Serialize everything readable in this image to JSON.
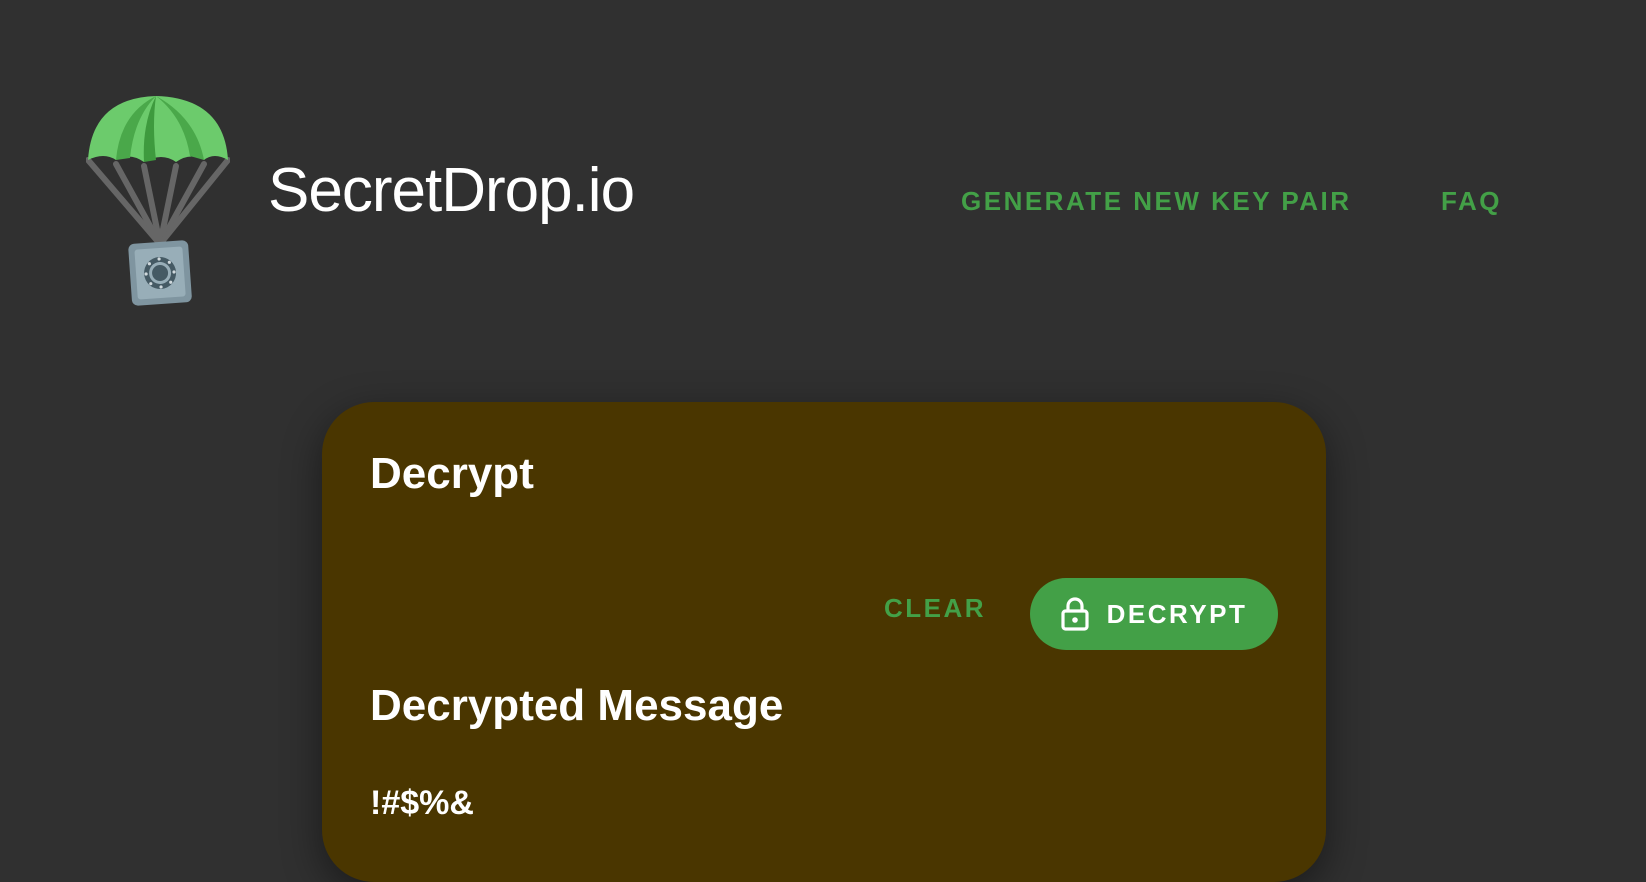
{
  "header": {
    "logo_icon": "parachute-safe-icon",
    "brand": "SecretDrop.io",
    "nav": [
      {
        "label": "GENERATE NEW KEY PAIR"
      },
      {
        "label": "FAQ"
      }
    ]
  },
  "card": {
    "title": "Decrypt",
    "clear_label": "CLEAR",
    "decrypt_label": "DECRYPT",
    "decrypt_icon": "lock-icon",
    "result_title": "Decrypted Message",
    "message": "!#$%&"
  },
  "colors": {
    "background": "#303030",
    "accent": "#43a047",
    "card": "#4a3600",
    "text": "#ffffff"
  }
}
